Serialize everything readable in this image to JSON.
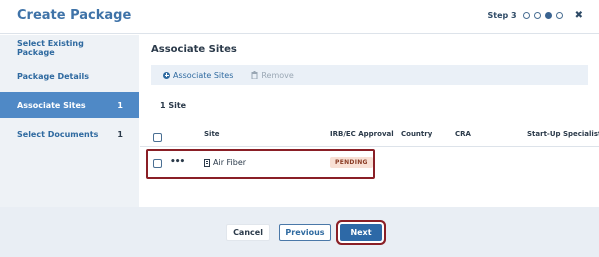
{
  "header": {
    "title": "Create Package",
    "step_label": "Step 3",
    "close_symbol": "✖"
  },
  "stepper": {
    "total": 4,
    "current": 3
  },
  "sidebar": {
    "items": [
      {
        "label": "Select Existing Package",
        "count": ""
      },
      {
        "label": "Package Details",
        "count": ""
      },
      {
        "label": "Associate Sites",
        "count": "1"
      },
      {
        "label": "Select Documents",
        "count": "1"
      }
    ]
  },
  "main": {
    "title": "Associate Sites",
    "toolbar": {
      "associate_label": "Associate Sites",
      "remove_label": "Remove"
    },
    "site_count": "1 Site",
    "columns": [
      "Site",
      "IRB/EC Approval Le",
      "Country",
      "CRA",
      "Start-Up Specialist"
    ],
    "rows": [
      {
        "more": "•••",
        "site": "Air Fiber",
        "status": "PENDING"
      }
    ]
  },
  "footer": {
    "cancel_label": "Cancel",
    "previous_label": "Previous",
    "next_label": "Next"
  },
  "colors": {
    "accent": "#2d69a7",
    "sidebar_active": "#4f89c6",
    "highlight": "#8a1f26",
    "pending_bg": "#f8e0d5"
  }
}
